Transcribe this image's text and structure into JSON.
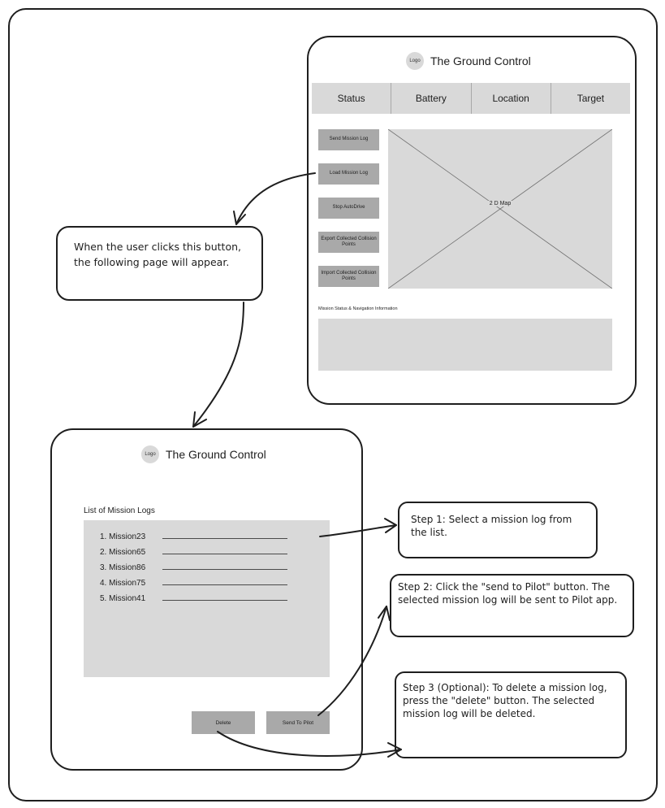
{
  "screen1": {
    "logo": "Logo",
    "title": "The Ground Control",
    "tabs": [
      "Status",
      "Battery",
      "Location",
      "Target"
    ],
    "side_buttons": [
      "Send Mission Log",
      "Load Mission Log",
      "Stop AutoDrive",
      "Export Collected Collision Points",
      "Import Collected Collision Points"
    ],
    "map_label": "2 D Map",
    "status_label": "Mission Status & Navigation Information"
  },
  "screen2": {
    "logo": "Logo",
    "title": "The Ground Control",
    "list_title": "List of Mission Logs",
    "missions": [
      "1. Mission23",
      "2. Mission65",
      "3. Mission86",
      "4. Mission75",
      "5. Mission41"
    ],
    "delete_label": "Delete",
    "send_label": "Send To Pilot"
  },
  "callouts": {
    "click_note": "When the user clicks this button, the following page will appear.",
    "step1": "Step 1: Select a mission log from the list.",
    "step2": "Step 2: Click the \"send to Pilot\" button. The selected mission log will be sent to Pilot app.",
    "step3": "Step 3 (Optional): To delete a mission log, press the \"delete\" button. The selected mission log will be deleted."
  },
  "colors": {
    "stroke": "#1e1e1e",
    "panel_fill": "#d9d9d9",
    "button_fill": "#a9a9a9"
  }
}
